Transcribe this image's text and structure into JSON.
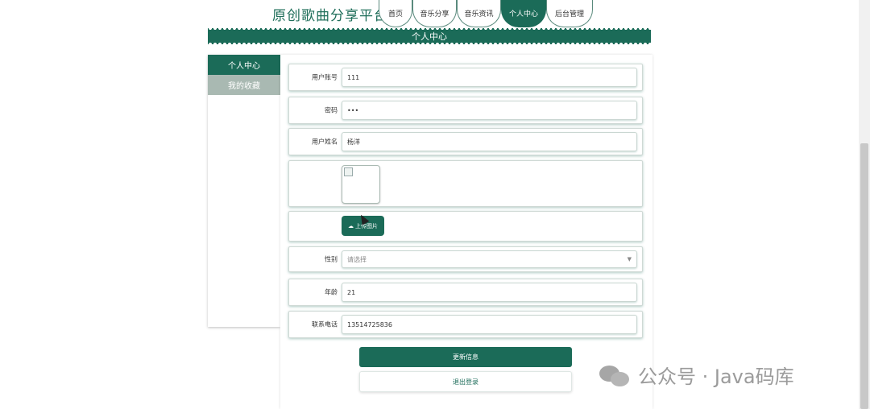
{
  "site": {
    "title": "原创歌曲分享平台"
  },
  "nav": {
    "tabs": [
      {
        "label": "首页"
      },
      {
        "label": "音乐分享"
      },
      {
        "label": "音乐资讯"
      },
      {
        "label": "个人中心",
        "active": true
      },
      {
        "label": "后台管理"
      }
    ]
  },
  "banner": {
    "title": "个人中心"
  },
  "sidebar": {
    "items": [
      {
        "label": "个人中心",
        "active": true
      },
      {
        "label": "我的收藏"
      }
    ]
  },
  "form": {
    "account": {
      "label": "用户账号",
      "value": "111"
    },
    "password": {
      "label": "密码",
      "value": "•••"
    },
    "name": {
      "label": "用户姓名",
      "value": "杨洋"
    },
    "upload": {
      "label": "上传图片"
    },
    "gender": {
      "label": "性别",
      "placeholder": "请选择"
    },
    "age": {
      "label": "年龄",
      "value": "21"
    },
    "phone": {
      "label": "联系电话",
      "value": "13514725836"
    }
  },
  "actions": {
    "update": "更新信息",
    "logout": "退出登录"
  },
  "watermark": {
    "text": "公众号 · Java码库"
  },
  "colors": {
    "primary": "#1b6b58",
    "sidebar_inactive": "#a9b9b2"
  }
}
